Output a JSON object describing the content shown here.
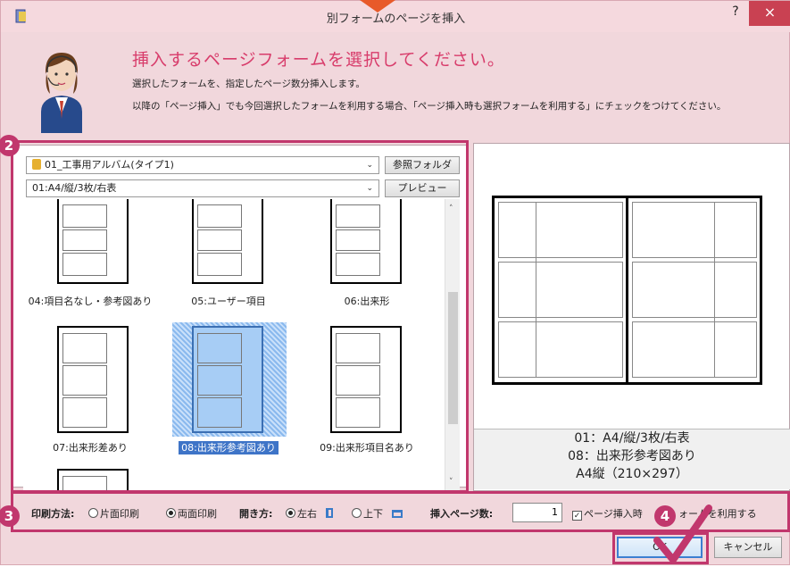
{
  "window": {
    "title": "別フォームのページを挿入",
    "help_label": "?",
    "close_label": "×"
  },
  "header": {
    "heading": "挿入するページフォームを選択してください。",
    "line1": "選択したフォームを、指定したページ数分挿入します。",
    "line2": "以降の「ページ挿入」でも今回選択したフォームを利用する場合、「ページ挿入時も選択フォームを利用する」にチェックをつけてください。"
  },
  "steps": {
    "s2": "2",
    "s3": "3",
    "s4": "4"
  },
  "left_panel": {
    "album_combo": "01_工事用アルバム(タイプ1)",
    "browse_button": "参照フォルダ",
    "layout_combo": "01:A4/縦/3枚/右表",
    "preview_button": "プレビュー",
    "thumbnails": [
      {
        "label": "04:項目名なし・参考図あり"
      },
      {
        "label": "05:ユーザー項目"
      },
      {
        "label": "06:出来形"
      },
      {
        "label": "07:出来形差あり"
      },
      {
        "label": "08:出来形参考図あり",
        "selected": true
      },
      {
        "label": "09:出来形項目名あり"
      }
    ]
  },
  "preview": {
    "line1": "01：A4/縦/3枚/右表",
    "line2": "08：出来形参考図あり",
    "line3": "A4縦（210×297）"
  },
  "options": {
    "print_label": "印刷方法:",
    "single_side": "片面印刷",
    "double_side": "両面印刷",
    "print_selected": "double_side",
    "open_label": "開き方:",
    "left_right": "左右",
    "top_bottom": "上下",
    "open_selected": "left_right",
    "pages_label": "挿入ページ数:",
    "pages_value": "1",
    "reuse_label": "ページ挿入時",
    "reuse_label2": "ォームを利用する",
    "reuse_checked": true
  },
  "buttons": {
    "ok": "OK",
    "cancel": "キャンセル"
  },
  "colors": {
    "accent": "#c1376d",
    "heading": "#d83c6b",
    "selection": "#3e74c7"
  }
}
